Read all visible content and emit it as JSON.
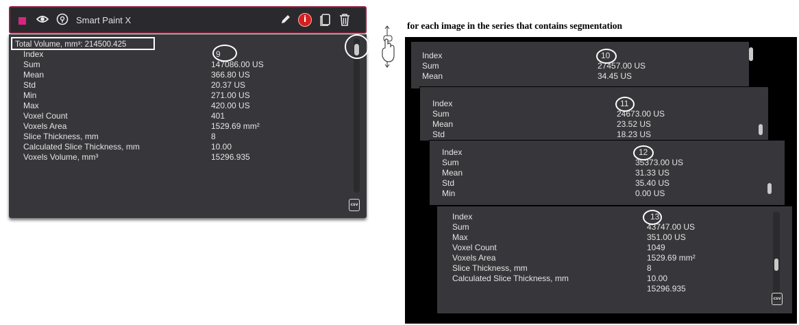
{
  "segmentation": {
    "name": "Smart Paint X",
    "color": "#d6257f",
    "total_volume": "Total Volume, mm³: 214500.425",
    "stats_labels": [
      "Index",
      "Sum",
      "Mean",
      "Std",
      "Min",
      "Max",
      "Voxel Count",
      "Voxels Area",
      "Slice Thickness, mm",
      "Calculated Slice Thickness, mm",
      "Voxels Volume, mm³"
    ],
    "stats_values": [
      "9",
      "147086.00 US",
      "366.80 US",
      "20.37 US",
      "271.00 US",
      "420.00 US",
      "401",
      "1529.69 mm²",
      "8",
      "10.00",
      "15296.935"
    ]
  },
  "icons": {
    "color": "color-swatch",
    "visibility": "eye-icon",
    "location": "locate-icon",
    "edit": "pencil-icon",
    "info": "info-icon",
    "copy": "copy-icon",
    "delete": "trash-icon",
    "export": "csv-icon",
    "scroll": "scroll-mouse-icon"
  },
  "caption": "for each image in the series that contains segmentation",
  "panels": [
    {
      "labels": [
        "Index",
        "Sum",
        "Mean"
      ],
      "values": [
        "10",
        "27457.00 US",
        "34.45 US"
      ]
    },
    {
      "labels": [
        "Index",
        "Sum",
        "Mean",
        "Std"
      ],
      "values": [
        "11",
        "24673.00 US",
        "23.52 US",
        "18.23 US"
      ]
    },
    {
      "labels": [
        "Index",
        "Sum",
        "Mean",
        "Std",
        "Min"
      ],
      "values": [
        "12",
        "35373.00 US",
        "31.33 US",
        "35.40 US",
        "0.00 US"
      ]
    },
    {
      "labels": [
        "Index",
        "Sum",
        "Max",
        "Voxel Count",
        "Voxels Area",
        "Slice Thickness, mm",
        "Calculated Slice Thickness, mm"
      ],
      "values": [
        "13",
        "43747.00 US",
        "351.00 US",
        "1049",
        "1529.69 mm²",
        "8",
        "10.00",
        "15296.935"
      ]
    }
  ],
  "export_label": "csv"
}
